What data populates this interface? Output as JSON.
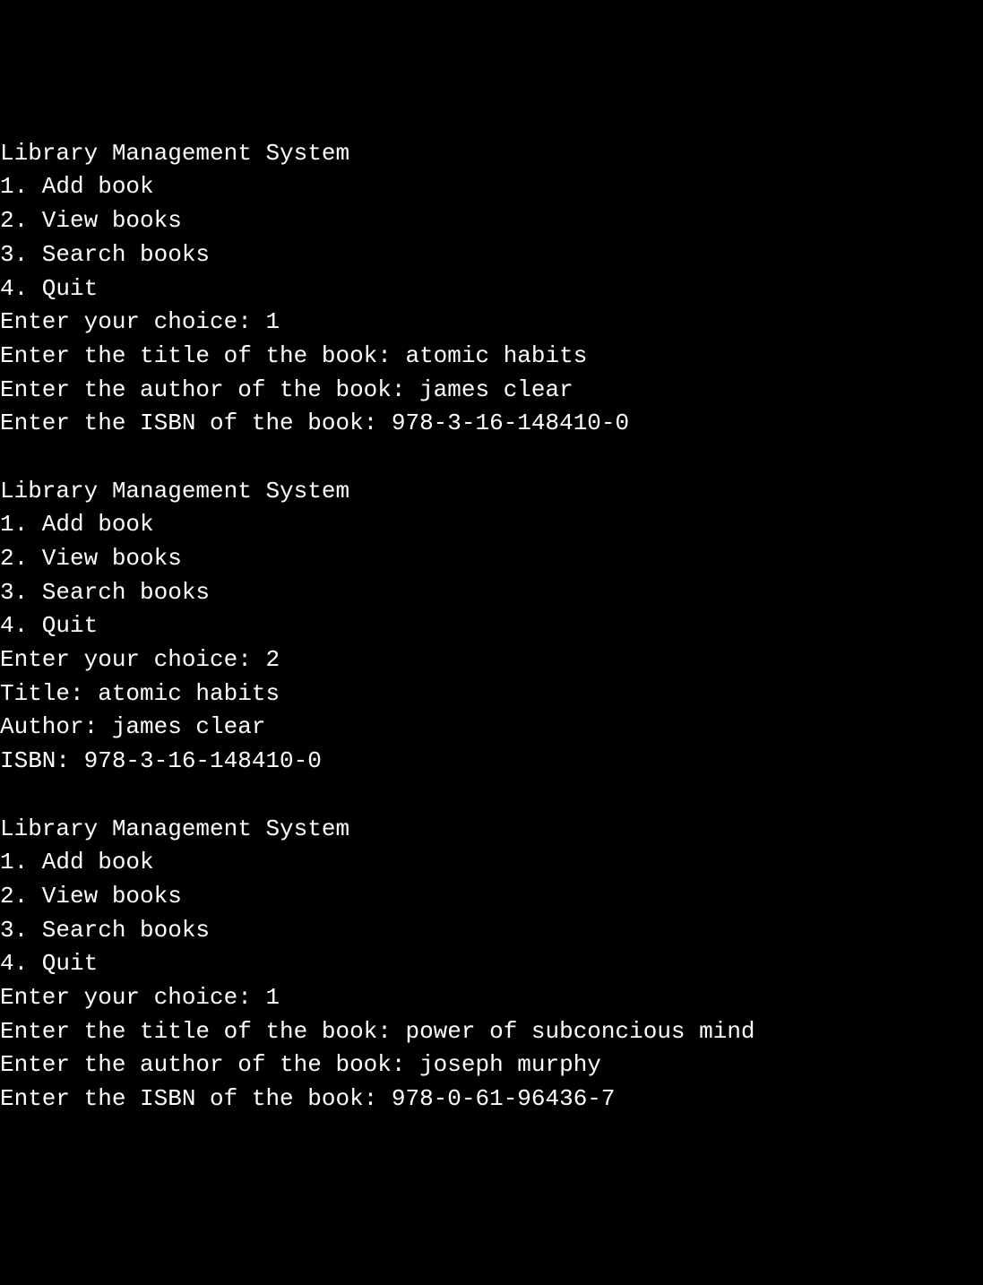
{
  "session1": {
    "header": "Library Management System",
    "menu1": "1. Add book",
    "menu2": "2. View books",
    "menu3": "3. Search books",
    "menu4": "4. Quit",
    "prompt_choice": "Enter your choice: 1",
    "prompt_title": "Enter the title of the book: atomic habits",
    "prompt_author": "Enter the author of the book: james clear",
    "prompt_isbn": "Enter the ISBN of the book: 978-3-16-148410-0"
  },
  "session2": {
    "header": "Library Management System",
    "menu1": "1. Add book",
    "menu2": "2. View books",
    "menu3": "3. Search books",
    "menu4": "4. Quit",
    "prompt_choice": "Enter your choice: 2",
    "output_title": "Title: atomic habits",
    "output_author": "Author: james clear",
    "output_isbn": "ISBN: 978-3-16-148410-0"
  },
  "session3": {
    "header": "Library Management System",
    "menu1": "1. Add book",
    "menu2": "2. View books",
    "menu3": "3. Search books",
    "menu4": "4. Quit",
    "prompt_choice": "Enter your choice: 1",
    "prompt_title": "Enter the title of the book: power of subconcious mind",
    "prompt_author": "Enter the author of the book: joseph murphy",
    "prompt_isbn": "Enter the ISBN of the book: 978-0-61-96436-7"
  }
}
